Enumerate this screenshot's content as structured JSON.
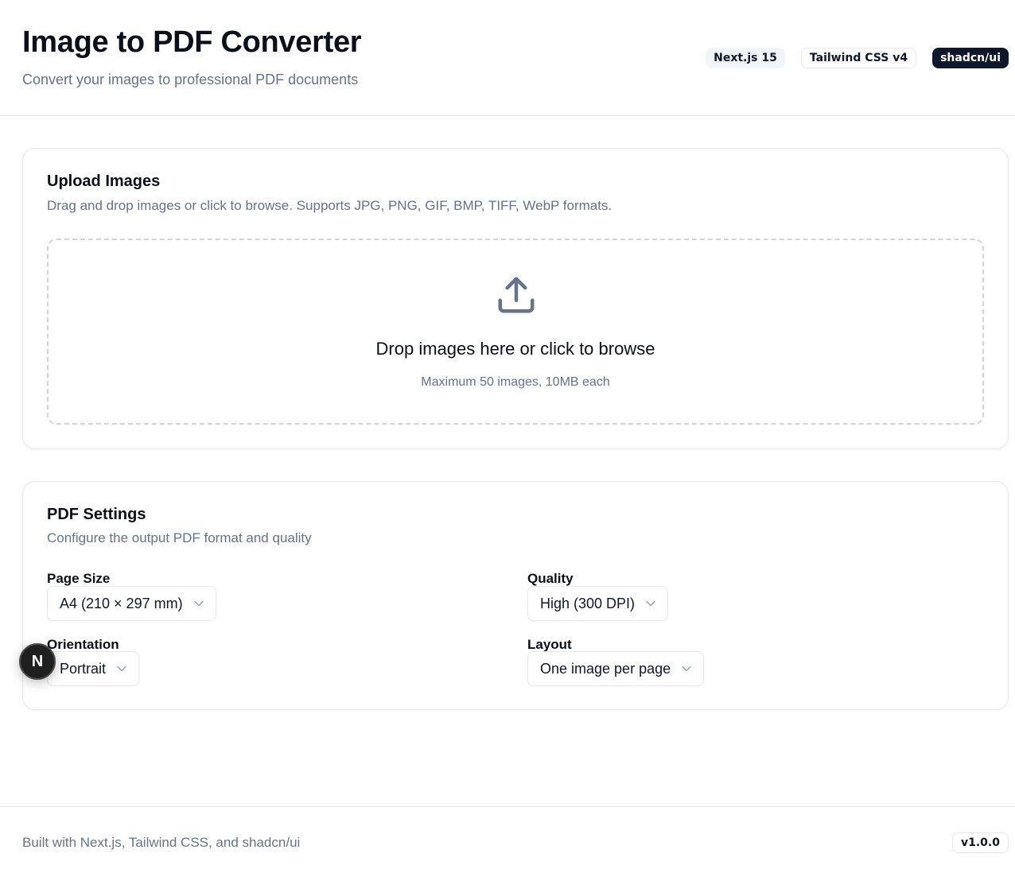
{
  "header": {
    "title": "Image to PDF Converter",
    "subtitle": "Convert your images to professional PDF documents",
    "badges": [
      "Next.js 15",
      "Tailwind CSS v4",
      "shadcn/ui"
    ]
  },
  "upload": {
    "title": "Upload Images",
    "description": "Drag and drop images or click to browse. Supports JPG, PNG, GIF, BMP, TIFF, WebP formats.",
    "drop_title": "Drop images here or click to browse",
    "drop_hint": "Maximum 50 images, 10MB each",
    "icon": "upload-icon"
  },
  "settings": {
    "title": "PDF Settings",
    "description": "Configure the output PDF format and quality",
    "page_size": {
      "label": "Page Size",
      "value": "A4 (210 × 297 mm)"
    },
    "quality": {
      "label": "Quality",
      "value": "High (300 DPI)"
    },
    "orientation": {
      "label": "Orientation",
      "value": "Portrait"
    },
    "layout": {
      "label": "Layout",
      "value": "One image per page"
    }
  },
  "footer": {
    "text": "Built with Next.js, Tailwind CSS, and shadcn/ui",
    "version": "v1.0.0"
  },
  "indicator": {
    "letter": "N"
  },
  "colors": {
    "muted_text": "#64748b",
    "border": "#e5e7eb",
    "dark_badge": "#0f172a",
    "icon_color": "#64748b"
  }
}
